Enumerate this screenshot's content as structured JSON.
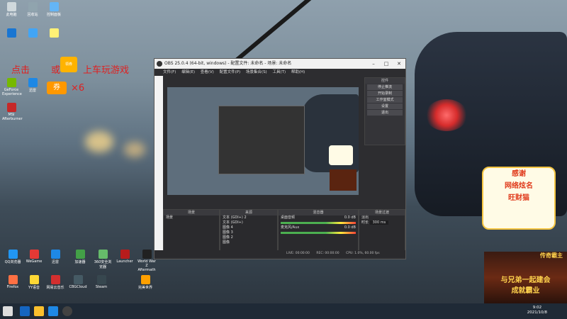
{
  "promo": {
    "text1": "点击",
    "text2": "或",
    "text3": "上车玩游戏",
    "coupon": "券",
    "multiplier": "×6",
    "badge": "领券"
  },
  "obs": {
    "title": "OBS 25.0.4 (64-bit, windows) - 配置文件: 未命名 - 场景: 未命名",
    "menu": [
      "文件(F)",
      "编辑(E)",
      "查看(V)",
      "配置文件(P)",
      "场景集合(S)",
      "工具(T)",
      "帮助(H)"
    ],
    "controls_header": "控件",
    "controls": [
      "停止推流",
      "开始录制",
      "工作室模式",
      "设置",
      "退出"
    ],
    "docks": {
      "scenes": {
        "header": "场景",
        "items": [
          "场景"
        ]
      },
      "sources": {
        "header": "来源",
        "items": [
          "文本 (GDI+) 2",
          "文本 (GDI+)",
          "图像 4",
          "图像 3",
          "图像 2",
          "图像"
        ]
      },
      "mixer": {
        "header": "混音器",
        "items": [
          "桌面音频",
          "麦克风/Aux"
        ],
        "level": "0.0 dB"
      },
      "transitions": {
        "header": "场景过渡",
        "type": "淡出",
        "duration_label": "时长",
        "duration": "300 ms"
      }
    },
    "status": {
      "live": "LIVE: 00:00:00",
      "rec": "REC: 00:00:00",
      "cpu": "CPU: 1.0%, 60.00 fps"
    }
  },
  "desktop_icons_left": [
    "此电脑",
    "回收站",
    "控制面板",
    "",
    "",
    "",
    "",
    "",
    "",
    "GeForce Experience",
    "迅雷",
    "",
    "MSI Afterburner"
  ],
  "desktop_icons_bottom": [
    "QQ浏览器",
    "WeGame",
    "迅雷",
    "加速器",
    "360安全浏览器",
    "Launcher",
    "World War Z Aftermath",
    "Firefox",
    "YY语音",
    "网易云音乐",
    "CBGCloud",
    "Steam",
    "完美世界"
  ],
  "sticker": {
    "line1": "感谢",
    "line2": "网络炫名",
    "line3": "旺财猫"
  },
  "banner": {
    "top": "传奇霸主",
    "line1": "与兄弟一起建会",
    "line2": "成就霸业"
  },
  "taskbar": {
    "time": "9:02",
    "date": "2021/10/8"
  }
}
